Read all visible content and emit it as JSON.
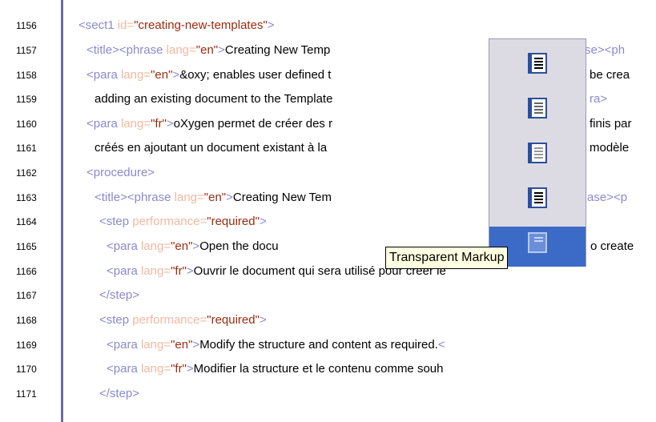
{
  "editor": {
    "lines": [
      {
        "n": "1156"
      },
      {
        "n": "1157"
      },
      {
        "n": "1158"
      },
      {
        "n": "1159"
      },
      {
        "n": "1160"
      },
      {
        "n": "1161"
      },
      {
        "n": "1162"
      },
      {
        "n": "1163"
      },
      {
        "n": "1164"
      },
      {
        "n": "1165"
      },
      {
        "n": "1166"
      },
      {
        "n": "1167"
      },
      {
        "n": "1168"
      },
      {
        "n": "1169"
      },
      {
        "n": "1170"
      },
      {
        "n": "1171"
      }
    ]
  },
  "code": {
    "l1156": {
      "t1": "<sect1 ",
      "a1": "id=",
      "v1": "\"creating-new-templates\"",
      "t2": ">"
    },
    "l1157": {
      "t1": "<title><phrase ",
      "a1": "lang=",
      "v1": "\"en\"",
      "t2": ">",
      "x1": "Creating New Temp",
      "t3": "se><ph"
    },
    "l1158": {
      "t1": "<para ",
      "a1": "lang=",
      "v1": "\"en\"",
      "t2": ">",
      "x1": "&oxy; enables user defined t",
      "x2": "be crea"
    },
    "l1159": {
      "x1": "adding an existing document to the Template",
      "t1": "ra>"
    },
    "l1160": {
      "t1": "<para ",
      "a1": "lang=",
      "v1": "\"fr\"",
      "t2": ">",
      "x1": "oXygen permet de créer des r",
      "x2": "finis par"
    },
    "l1161": {
      "x1": "créés en ajoutant un document existant à la",
      "x2": "modèle"
    },
    "l1162": {
      "t1": "<procedure>"
    },
    "l1163": {
      "t1": "<title><phrase ",
      "a1": "lang=",
      "v1": "\"en\"",
      "t2": ">",
      "x1": "Creating New Tem",
      "t3": "ase><p"
    },
    "l1164": {
      "t1": "<step ",
      "a1": "performance=",
      "v1": "\"required\"",
      "t2": ">"
    },
    "l1165": {
      "t1": "<para ",
      "a1": "lang=",
      "v1": "\"en\"",
      "t2": ">",
      "x1": "Open the docu",
      "x2": "o create"
    },
    "l1166": {
      "t1": "<para ",
      "a1": "lang=",
      "v1": "\"fr\"",
      "t2": ">",
      "x1": "Ouvrir le document qui sera utilisé pour créer le"
    },
    "l1167": {
      "t1": "</step>"
    },
    "l1168": {
      "t1": "<step ",
      "a1": "performance=",
      "v1": "\"required\"",
      "t2": ">"
    },
    "l1169": {
      "t1": "<para ",
      "a1": "lang=",
      "v1": "\"en\"",
      "t2": ">",
      "x1": "Modify the structure and content as required.",
      "t3": "<"
    },
    "l1170": {
      "t1": "<para ",
      "a1": "lang=",
      "v1": "\"fr\"",
      "t2": ">",
      "x1": "Modifier la structure et le contenu comme souh"
    },
    "l1171": {
      "t1": "</step>"
    }
  },
  "popup": {
    "items": [
      {
        "icon": "tags-full-icon"
      },
      {
        "icon": "tags-partial-icon"
      },
      {
        "icon": "tags-inline-icon"
      },
      {
        "icon": "tags-block-icon"
      },
      {
        "icon": "tags-transparent-icon"
      }
    ],
    "selected_index": 4
  },
  "tooltip": {
    "text": "Transparent Markup"
  },
  "colors": {
    "tag": "#8a8ad0",
    "attr": "#f3b8a2",
    "value": "#9a2b0e",
    "gutter_border": "#6c6ca8",
    "popup_bg": "#dcdbe4",
    "selected": "#3b6bc7"
  }
}
